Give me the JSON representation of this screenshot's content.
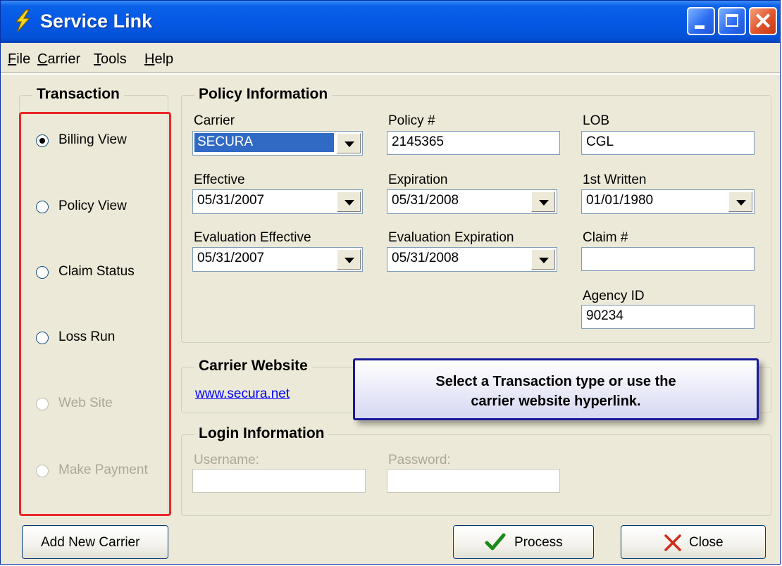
{
  "window": {
    "title": "Service Link",
    "icon": "lightning-bolt-icon"
  },
  "menu": [
    {
      "pre": "",
      "u": "F",
      "post": "ile"
    },
    {
      "pre": "",
      "u": "C",
      "post": "arrier"
    },
    {
      "pre": "",
      "u": "T",
      "post": "ools"
    },
    {
      "pre": "",
      "u": "H",
      "post": "elp"
    }
  ],
  "transaction": {
    "title": "Transaction",
    "options": [
      {
        "label": "Billing View",
        "checked": true,
        "enabled": true
      },
      {
        "label": "Policy View",
        "checked": false,
        "enabled": true
      },
      {
        "label": "Claim Status",
        "checked": false,
        "enabled": true
      },
      {
        "label": "Loss Run",
        "checked": false,
        "enabled": true
      },
      {
        "label": "Web Site",
        "checked": false,
        "enabled": false
      },
      {
        "label": "Make Payment",
        "checked": false,
        "enabled": false
      }
    ]
  },
  "policy": {
    "title": "Policy Information",
    "carrier": {
      "label": "Carrier",
      "value": "SECURA"
    },
    "policy_no": {
      "label": "Policy #",
      "value": "2145365"
    },
    "lob": {
      "label": "LOB",
      "value": "CGL"
    },
    "effective": {
      "label": "Effective",
      "value": "05/31/2007"
    },
    "expiration": {
      "label": "Expiration",
      "value": "05/31/2008"
    },
    "first_written": {
      "label": "1st Written",
      "value": "01/01/1980"
    },
    "eval_effective": {
      "label": "Evaluation Effective",
      "value": "05/31/2007"
    },
    "eval_expiration": {
      "label": "Evaluation Expiration",
      "value": "05/31/2008"
    },
    "claim_no": {
      "label": "Claim #",
      "value": ""
    },
    "agency_id": {
      "label": "Agency ID",
      "value": "90234"
    }
  },
  "carrier_website": {
    "title": "Carrier Website",
    "link": "www.secura.net"
  },
  "callout": {
    "line1": "Select a Transaction type or use the",
    "line2": "carrier website hyperlink."
  },
  "login": {
    "title": "Login Information",
    "username_label": "Username:",
    "password_label": "Password:",
    "username_value": "",
    "password_value": ""
  },
  "buttons": {
    "add_carrier": "Add New Carrier",
    "process": "Process",
    "close": "Close"
  },
  "colors": {
    "highlight_box": "#e8282a",
    "title_bar": "#0558e6",
    "callout_border": "#19199c",
    "link": "#0000ff"
  }
}
